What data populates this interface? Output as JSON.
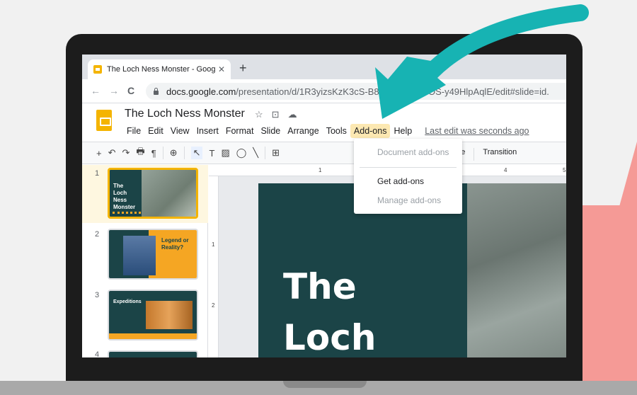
{
  "browser": {
    "tab_title": "The Loch Ness Monster - Goog",
    "tab_close": "✕",
    "new_tab": "+",
    "back": "←",
    "forward": "→",
    "reload": "C",
    "url_host": "docs.google.com",
    "url_path": "/presentation/d/1R3yizsKzK3cS-B8ANU",
    "url_tail": "GP_WfOS-y49HlpAqlE/edit#slide=id."
  },
  "doc": {
    "title": "The Loch Ness Monster",
    "star_icon": "☆",
    "move_icon": "⊡",
    "cloud_icon": "☁"
  },
  "menu": {
    "file": "File",
    "edit": "Edit",
    "view": "View",
    "insert": "Insert",
    "format": "Format",
    "slide": "Slide",
    "arrange": "Arrange",
    "tools": "Tools",
    "addons": "Add-ons",
    "help": "Help",
    "last_edit": "Last edit was seconds ago"
  },
  "toolbar": {
    "add": "+",
    "undo": "↶",
    "redo": "↷",
    "print": "🖶",
    "paint": "¶",
    "zoom": "⊕",
    "select": "↖",
    "textbox": "T",
    "image": "▨",
    "shape": "◯",
    "line": "╲",
    "comment": "⊞",
    "theme": "eme",
    "transition": "Transition"
  },
  "addons_menu": {
    "document_addons": "Document add-ons",
    "get_addons": "Get add-ons",
    "manage_addons": "Manage add-ons"
  },
  "slides": [
    {
      "num": "1",
      "title_lines": [
        "The",
        "Loch",
        "Ness",
        "Monster"
      ]
    },
    {
      "num": "2",
      "title_lines": [
        "Legend or",
        "Reality?"
      ]
    },
    {
      "num": "3",
      "title": "Expeditions"
    },
    {
      "num": "4"
    }
  ],
  "ruler": {
    "h1": "1",
    "h4": "4",
    "h5": "5",
    "v1": "1",
    "v2": "2"
  },
  "main_slide": {
    "title_line1": "The",
    "title_line2": "Loch"
  },
  "colors": {
    "arrow": "#17b3b3",
    "accent": "#f4b400",
    "slide_dark": "#1b4447",
    "slide_orange": "#f5a623",
    "bg_triangle": "#f59a96"
  }
}
